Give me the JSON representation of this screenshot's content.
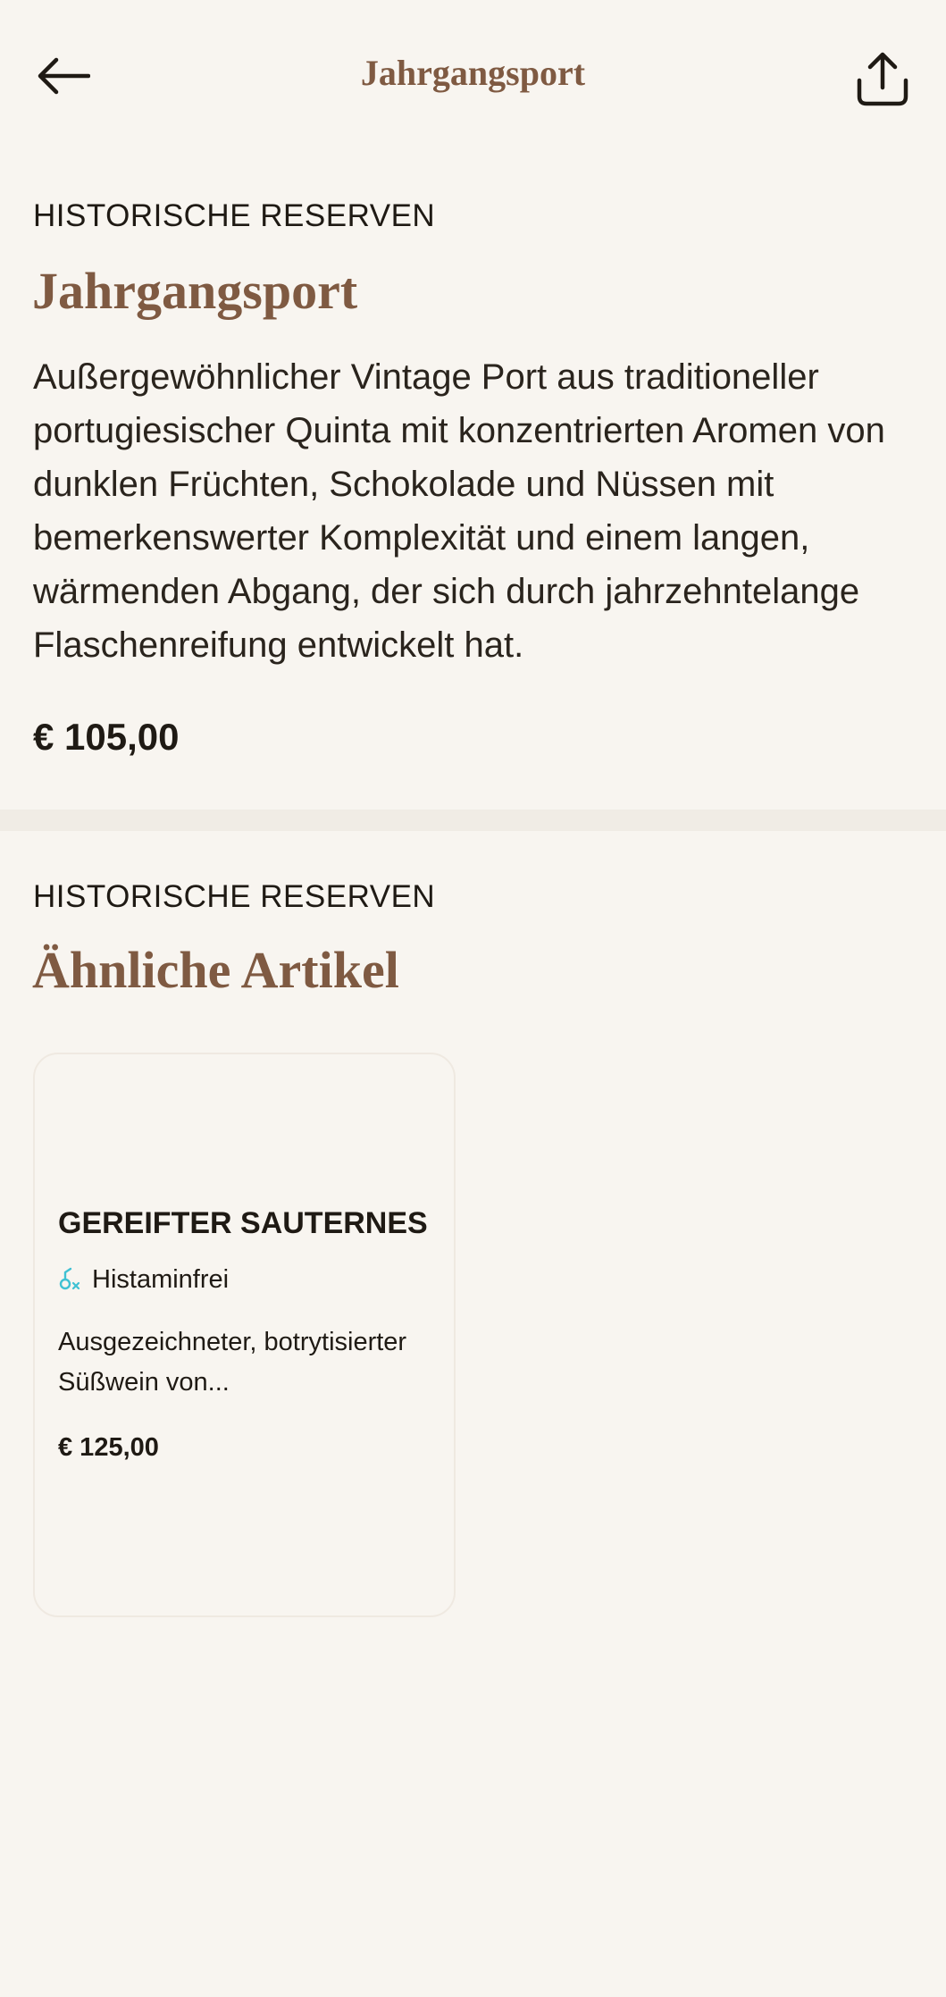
{
  "header": {
    "title": "Jahrgangsport",
    "back_icon": "arrow-left-icon",
    "share_icon": "share-icon"
  },
  "product": {
    "category": "HISTORISCHE RESERVEN",
    "name": "Jahrgangsport",
    "description": "Außergewöhnlicher Vintage Port aus traditioneller portugiesischer Quinta mit konzentrierten Aromen von dunklen Früchten, Schokolade und Nüssen mit bemerkenswerter Komplexität und einem langen, wärmenden Abgang, der sich durch jahrzehntelange Flaschenreifung entwickelt hat.",
    "price": "€ 105,00"
  },
  "similar": {
    "category": "HISTORISCHE RESERVEN",
    "title": "Ähnliche Artikel",
    "items": [
      {
        "name": "GEREIFTER SAUTERNES",
        "badge_icon": "histamine-free-icon",
        "badge_label": "Histaminfrei",
        "description": "Ausgezeichneter, botrytisierter Süßwein von...",
        "price": "€ 125,00"
      }
    ]
  },
  "colors": {
    "background": "#f8f5f0",
    "accent_brown": "#7f5a42",
    "text_dark": "#1f1a14",
    "badge_cyan": "#3fc1d3"
  }
}
